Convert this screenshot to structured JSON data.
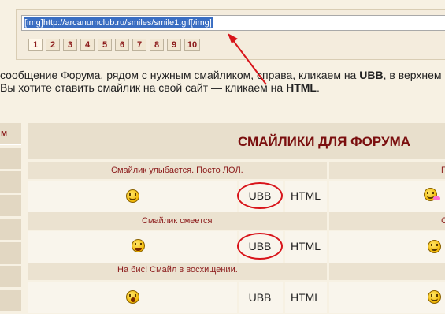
{
  "code_field": {
    "value": "[img]http://arcanumclub.ru/smiles/smile1.gif[/img]"
  },
  "pager": [
    "1",
    "2",
    "3",
    "4",
    "5",
    "6",
    "7",
    "8",
    "9",
    "10"
  ],
  "description": {
    "line1_a": "сообщение Форума, рядом с нужным смайликом, справа, кликаем на ",
    "line1_ubb": "UBB",
    "line1_b": ", в верхнем",
    "line2_a": "Вы хотите ставить смайлик на свой сайт — кликаем на ",
    "line2_html": "HTML",
    "line2_b": "."
  },
  "left_column": {
    "header": "м"
  },
  "table": {
    "title": "СМАЙЛИКИ ДЛЯ ФОРУМА",
    "rows": [
      {
        "caption": "Смайлик улыбается. Посто ЛОЛ.",
        "ubb": "UBB",
        "html": "HTML",
        "right_caption": "П",
        "icon": "grin-smiley-icon"
      },
      {
        "caption": "Смайлик смеется",
        "ubb": "UBB",
        "html": "HTML",
        "right_caption": "С",
        "icon": "laughing-smiley-icon"
      },
      {
        "caption": "На бис! Смайл в восхищении.",
        "ubb": "UBB",
        "html": "HTML",
        "right_caption": "",
        "icon": "amazed-smiley-icon"
      }
    ]
  },
  "colors": {
    "title": "#7a0e0e",
    "caption": "#8b1a1a",
    "annotation": "#d8141a",
    "selection": "#3a6ec2"
  }
}
